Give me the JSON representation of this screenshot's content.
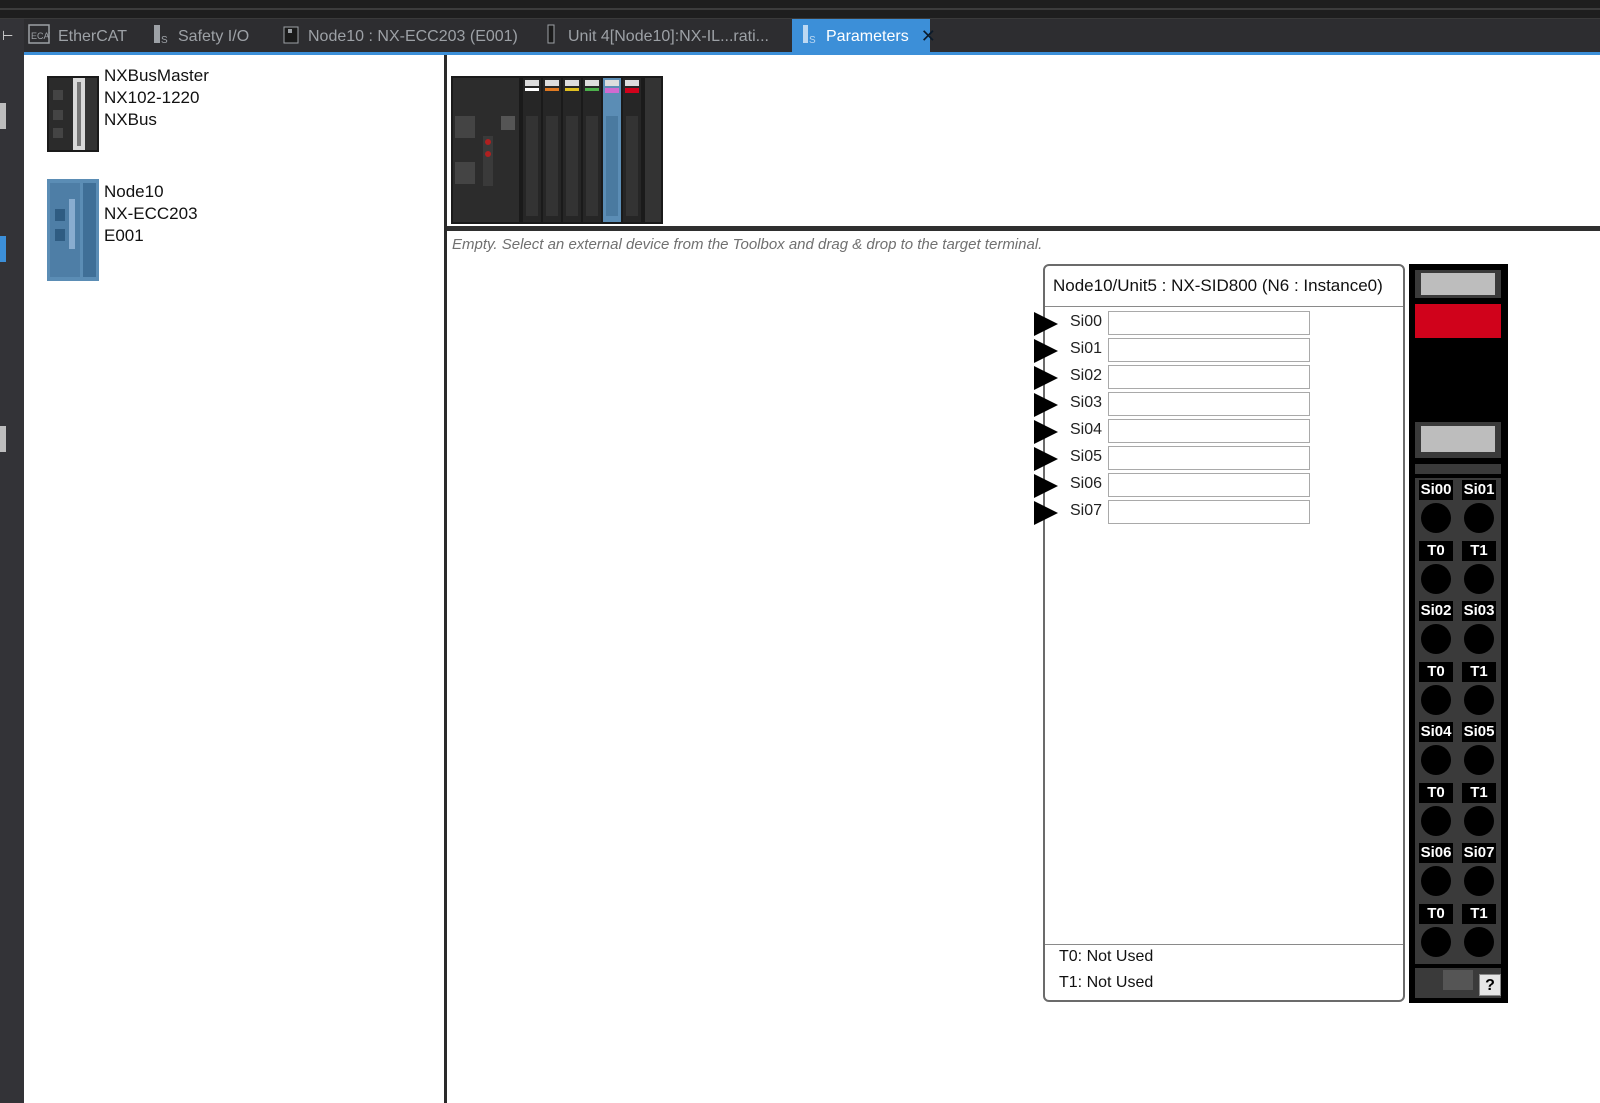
{
  "tabs": [
    {
      "label": "EtherCAT",
      "icon": "ethercat-icon",
      "active": false
    },
    {
      "label": "Safety I/O",
      "icon": "safety-io-icon",
      "active": false
    },
    {
      "label": "Node10 : NX-ECC203 (E001)",
      "icon": "coupler-icon",
      "active": false
    },
    {
      "label": "Unit 4[Node10]:NX-IL...rati...",
      "icon": "unit-icon",
      "active": false
    },
    {
      "label": "Parameters",
      "icon": "parameters-icon",
      "active": true
    }
  ],
  "tree": [
    {
      "line1": "NXBusMaster",
      "line2": "NX102-1220",
      "line3": "NXBus"
    },
    {
      "line1": "Node10",
      "line2": "NX-ECC203",
      "line3": "E001"
    }
  ],
  "hint": "Empty. Select an external device from the Toolbox and drag & drop to the target terminal.",
  "card": {
    "title": "Node10/Unit5 : NX-SID800 (N6 : Instance0)",
    "terminals": [
      "Si00",
      "Si01",
      "Si02",
      "Si03",
      "Si04",
      "Si05",
      "Si06",
      "Si07"
    ],
    "footer": [
      "T0: Not Used",
      "T1: Not Used"
    ]
  },
  "device": {
    "pin_pairs": [
      [
        "Si00",
        "Si01"
      ],
      [
        "T0",
        "T1"
      ],
      [
        "Si02",
        "Si03"
      ],
      [
        "T0",
        "T1"
      ],
      [
        "Si04",
        "Si05"
      ],
      [
        "T0",
        "T1"
      ],
      [
        "Si06",
        "Si07"
      ],
      [
        "T0",
        "T1"
      ]
    ],
    "help_label": "?",
    "indicator_color": "#d0021b"
  },
  "colors": {
    "accent": "#3c8fd8",
    "tab_bg": "#2d2d30"
  }
}
